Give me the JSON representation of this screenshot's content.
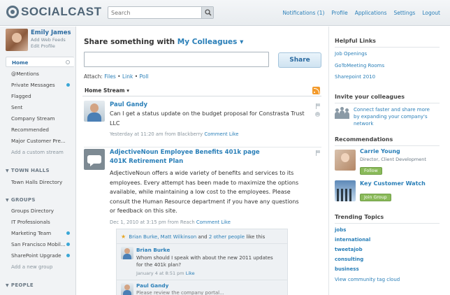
{
  "header": {
    "logo_text": "SOCIALCAST",
    "search_placeholder": "Search",
    "nav": [
      "Notifications (1)",
      "Profile",
      "Applications",
      "Settings",
      "Logout"
    ]
  },
  "profile": {
    "name": "Emily James",
    "links": [
      "Add Web Feeds",
      "Edit Profile"
    ]
  },
  "sidebar": {
    "main_items": [
      {
        "label": "Home",
        "active": true,
        "dot": "grey"
      },
      {
        "label": "@Mentions",
        "dot": ""
      },
      {
        "label": "Private Messages",
        "dot": "blue"
      },
      {
        "label": "Flagged",
        "dot": ""
      },
      {
        "label": "Sent",
        "dot": ""
      },
      {
        "label": "Company Stream",
        "dot": ""
      },
      {
        "label": "Recommended",
        "dot": ""
      },
      {
        "label": "Major Customer Pre...",
        "dot": ""
      }
    ],
    "add_stream": "Add a custom stream",
    "town_halls_header": "TOWN HALLS",
    "town_halls_items": [
      "Town Halls Directory"
    ],
    "groups_header": "GROUPS",
    "groups_items": [
      {
        "label": "Groups Directory",
        "dot": ""
      },
      {
        "label": "IT Professionals",
        "dot": ""
      },
      {
        "label": "Marketing Team",
        "dot": "blue"
      },
      {
        "label": "San Francisco Mobil...",
        "dot": "blue"
      },
      {
        "label": "SharePoint Upgrade",
        "dot": "blue"
      }
    ],
    "add_group": "Add a new group",
    "people_header": "PEOPLE"
  },
  "share": {
    "prefix": "Share something with",
    "audience": "My Colleagues",
    "button": "Share",
    "attach_label": "Attach:",
    "attach_options": [
      "Files",
      "Link",
      "Poll"
    ]
  },
  "stream": {
    "title": "Home Stream",
    "posts": [
      {
        "author": "Paul Gandy",
        "text": "Can I get a status update on the budget proposal for Constrasta Trust LLC",
        "time": "Yesterday at 11:20 am from Blackberry",
        "comment": "Comment",
        "like": "Like"
      },
      {
        "author": "AdjectiveNoun Employee Benefits 401k page",
        "subtitle": "401K Retirement Plan",
        "text": "AdjectiveNoun offers a wide variety of benefits and services to its employees. Every attempt has been made to maximize the options available, while maintaining a low cost to the employees. Please consult the Human Resource department if you have any questions or feedback on this site.",
        "time": "Dec 1, 2010 at 3:15 pm from Reach",
        "comment": "Comment",
        "like": "Like",
        "likes": {
          "names": "Brian Burke, Matt Wilkinson",
          "and": "and",
          "others": "2 other people",
          "suffix": "like this"
        },
        "comments": [
          {
            "author": "Brian Burke",
            "text": "Whom should I speak with about the new 2011 updates for the 401k plan?",
            "time": "January 4 at 8:51 pm",
            "like": "Like"
          },
          {
            "author": "Paul Gandy",
            "text": "Please review the company portal..."
          }
        ]
      }
    ]
  },
  "right": {
    "helpful_title": "Helpful Links",
    "helpful_links": [
      "Job Openings",
      "GoToMeeting Rooms",
      "Sharepoint 2010"
    ],
    "invite_title": "Invite your colleagues",
    "invite_text": "Connect faster and share more by expanding your company's network",
    "rec_title": "Recommendations",
    "recommendations": [
      {
        "name": "Carrie Young",
        "sub": "Director, Client Development",
        "button": "Follow"
      },
      {
        "name": "Key Customer Watch",
        "sub": "",
        "button": "Join Group"
      }
    ],
    "trending_title": "Trending Topics",
    "topics": [
      "jobs",
      "international",
      "tweetajob",
      "consulting",
      "business"
    ],
    "tag_cloud": "View community tag cloud"
  },
  "colors": {
    "link": "#2a7fb8",
    "accent_blue_dot": "#3ba7d6",
    "join_green": "#8aba5a",
    "rss_orange": "#f39a2b"
  }
}
